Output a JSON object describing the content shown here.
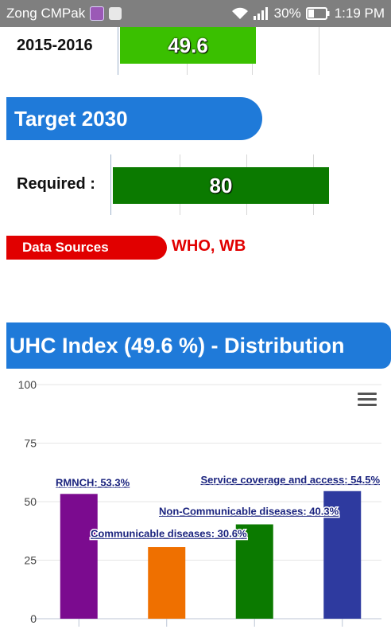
{
  "status_bar": {
    "carrier": "Zong CMPak",
    "battery": "30%",
    "time": "1:19 PM"
  },
  "baseline": {
    "label": "2015-2016",
    "value": "49.6",
    "fraction": 0.496,
    "color": "#3ac000"
  },
  "target": {
    "header": "Target 2030",
    "label": "Required :",
    "value": "80",
    "fraction": 0.8,
    "color": "#0b7a00"
  },
  "data_sources": {
    "label": "Data Sources",
    "value": "WHO, WB"
  },
  "distribution": {
    "header": "UHC Index (49.6 %) - Distribution"
  },
  "chart_data": {
    "type": "bar",
    "categories": [
      "RMNCH",
      "Communicable diseases",
      "Non-Communicable diseases",
      "Service coverage and access"
    ],
    "values": [
      53.3,
      30.6,
      40.3,
      54.5
    ],
    "colors": [
      "#7b0b8f",
      "#ef7000",
      "#0b7a00",
      "#2e3a9f"
    ],
    "data_labels": [
      "RMNCH: 53.3%",
      "Communicable diseases: 30.6%",
      "Non-Communicable diseases: 40.3%",
      "Service coverage and access: 54.5%"
    ],
    "yticks": [
      "0",
      "25",
      "50",
      "75",
      "100"
    ],
    "ylim": [
      0,
      100
    ],
    "grid": true,
    "legend": "none"
  }
}
